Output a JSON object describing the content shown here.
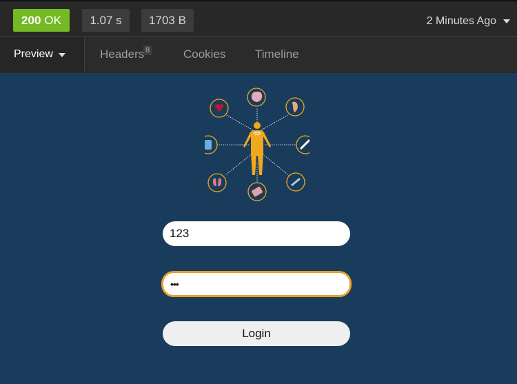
{
  "response": {
    "status_code": "200",
    "status_text": "OK",
    "duration": "1.07 s",
    "size": "1703 B",
    "time_ago": "2 Minutes Ago"
  },
  "tabs": {
    "preview": "Preview",
    "headers": "Headers",
    "headers_count": "8",
    "cookies": "Cookies",
    "timeline": "Timeline"
  },
  "login_form": {
    "username_value": "123",
    "password_value": "•••",
    "login_label": "Login"
  },
  "colors": {
    "status_ok": "#75ba24",
    "page_background": "#1a3c5c",
    "accent_gold": "#e6a127"
  },
  "icons": [
    "heart-icon",
    "brain-icon",
    "ear-icon",
    "smartphone-icon",
    "syringe-icon",
    "lungs-icon",
    "pills-icon",
    "thermometer-icon",
    "human-figure-icon",
    "wifi-icon"
  ]
}
